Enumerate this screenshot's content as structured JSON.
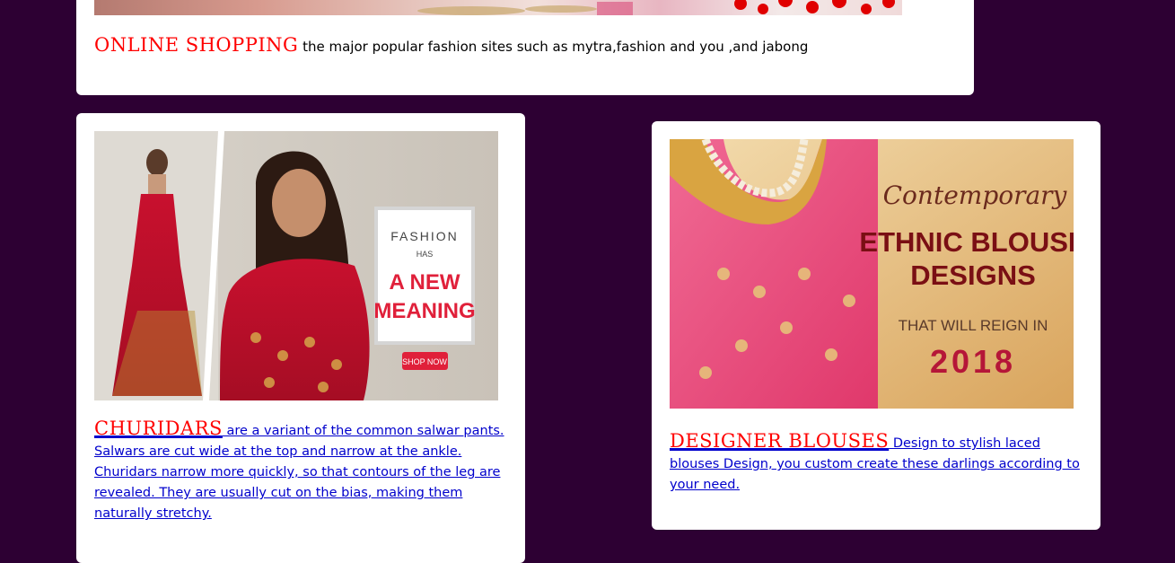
{
  "top_card": {
    "heading": "ONLINE SHOPPING",
    "text": " the major popular fashion sites such as mytra,fashion and you ,and jabong"
  },
  "left_card": {
    "image_text": {
      "line1": "FASHION",
      "line2": "HAS",
      "line3": "A NEW",
      "line4": "MEANING",
      "button": "SHOP NOW"
    },
    "heading": "CHURIDARS",
    "text": " are a variant of the common salwar pants. Salwars are cut wide at the top and narrow at the ankle. Churidars narrow more quickly, so that contours of the leg are revealed. They are usually cut on the bias, making them naturally stretchy."
  },
  "right_card": {
    "image_text": {
      "line1": "Contemporary",
      "line2": "ETHNIC BLOUSE",
      "line3": "DESIGNS",
      "line4": "THAT WILL REIGN IN",
      "line5": "2018"
    },
    "heading": "DESIGNER BLOUSES",
    "text": " Design to stylish laced blouses Design, you custom create these darlings according to your need."
  },
  "colors": {
    "background": "#2d0033",
    "heading": "#ff0000",
    "link": "#0000cc"
  }
}
